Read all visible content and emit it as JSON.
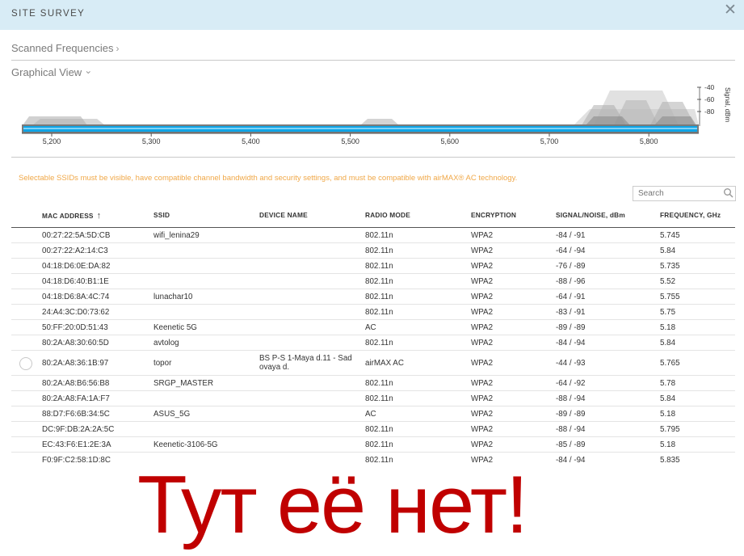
{
  "dialog": {
    "title": "SITE SURVEY",
    "close_symbol": "✕",
    "close_icon": "close-icon"
  },
  "sections": {
    "scanned_frequencies": "Scanned Frequencies",
    "scanned_chevron": "›",
    "graphical_view": "Graphical View",
    "graphical_chevron": "⌄"
  },
  "chart": {
    "x_ticks": [
      "5,200",
      "5,300",
      "5,400",
      "5,500",
      "5,600",
      "5,700",
      "5,800"
    ],
    "y_ticks": [
      "-40",
      "-60",
      "-80"
    ],
    "y_label": "Signal, dBm",
    "colors": {
      "band": "#0fa4e6",
      "band_highlight": "#7fd3f7",
      "peaks": "#9b9b9b"
    }
  },
  "notice": "Selectable SSIDs must be visible, have compatible channel bandwidth and security settings, and must be compatible with airMAX® AC technology.",
  "search": {
    "placeholder": "Search",
    "icon": "search-icon"
  },
  "table": {
    "headers": {
      "mac": "MAC ADDRESS",
      "mac_sort": "↑",
      "ssid": "SSID",
      "device": "DEVICE NAME",
      "radio": "RADIO MODE",
      "enc": "ENCRYPTION",
      "signal": "SIGNAL/NOISE, dBm",
      "freq": "FREQUENCY, GHz"
    },
    "rows": [
      {
        "mac": "00:27:22:5A:5D:CB",
        "ssid": "wifi_lenina29",
        "device": "",
        "radio": "802.11n",
        "enc": "WPA2",
        "signal": "-84 / -91",
        "freq": "5.745"
      },
      {
        "mac": "00:27:22:A2:14:C3",
        "ssid": "",
        "device": "",
        "radio": "802.11n",
        "enc": "WPA2",
        "signal": "-64 / -94",
        "freq": "5.84"
      },
      {
        "mac": "04:18:D6:0E:DA:82",
        "ssid": "",
        "device": "",
        "radio": "802.11n",
        "enc": "WPA2",
        "signal": "-76 / -89",
        "freq": "5.735"
      },
      {
        "mac": "04:18:D6:40:B1:1E",
        "ssid": "",
        "device": "",
        "radio": "802.11n",
        "enc": "WPA2",
        "signal": "-88 / -96",
        "freq": "5.52"
      },
      {
        "mac": "04:18:D6:8A:4C:74",
        "ssid": "lunachar10",
        "device": "",
        "radio": "802.11n",
        "enc": "WPA2",
        "signal": "-64 / -91",
        "freq": "5.755"
      },
      {
        "mac": "24:A4:3C:D0:73:62",
        "ssid": "",
        "device": "",
        "radio": "802.11n",
        "enc": "WPA2",
        "signal": "-83 / -91",
        "freq": "5.75"
      },
      {
        "mac": "50:FF:20:0D:51:43",
        "ssid": "Keenetic 5G",
        "device": "",
        "radio": "AC",
        "enc": "WPA2",
        "signal": "-89 / -89",
        "freq": "5.18"
      },
      {
        "mac": "80:2A:A8:30:60:5D",
        "ssid": "avtolog",
        "device": "",
        "radio": "802.11n",
        "enc": "WPA2",
        "signal": "-84 / -94",
        "freq": "5.84"
      },
      {
        "mac": "80:2A:A8:36:1B:97",
        "ssid": "topor",
        "device": "BS P-S 1-Maya d.11 - Sad ovaya d.",
        "radio": "airMAX AC",
        "enc": "WPA2",
        "signal": "-44 / -93",
        "freq": "5.765",
        "selectable": true
      },
      {
        "mac": "80:2A:A8:B6:56:B8",
        "ssid": "SRGP_MASTER",
        "device": "",
        "radio": "802.11n",
        "enc": "WPA2",
        "signal": "-64 / -92",
        "freq": "5.78"
      },
      {
        "mac": "80:2A:A8:FA:1A:F7",
        "ssid": "",
        "device": "",
        "radio": "802.11n",
        "enc": "WPA2",
        "signal": "-88 / -94",
        "freq": "5.84"
      },
      {
        "mac": "88:D7:F6:6B:34:5C",
        "ssid": "ASUS_5G",
        "device": "",
        "radio": "AC",
        "enc": "WPA2",
        "signal": "-89 / -89",
        "freq": "5.18"
      },
      {
        "mac": "DC:9F:DB:2A:2A:5C",
        "ssid": "",
        "device": "",
        "radio": "802.11n",
        "enc": "WPA2",
        "signal": "-88 / -94",
        "freq": "5.795"
      },
      {
        "mac": "EC:43:F6:E1:2E:3A",
        "ssid": "Keenetic-3106-5G",
        "device": "",
        "radio": "802.11n",
        "enc": "WPA2",
        "signal": "-85 / -89",
        "freq": "5.18"
      },
      {
        "mac": "F0:9F:C2:58:1D:8C",
        "ssid": "",
        "device": "",
        "radio": "802.11n",
        "enc": "WPA2",
        "signal": "-84 / -94",
        "freq": "5.835"
      }
    ]
  },
  "overlay_text": "Тут её нет!"
}
